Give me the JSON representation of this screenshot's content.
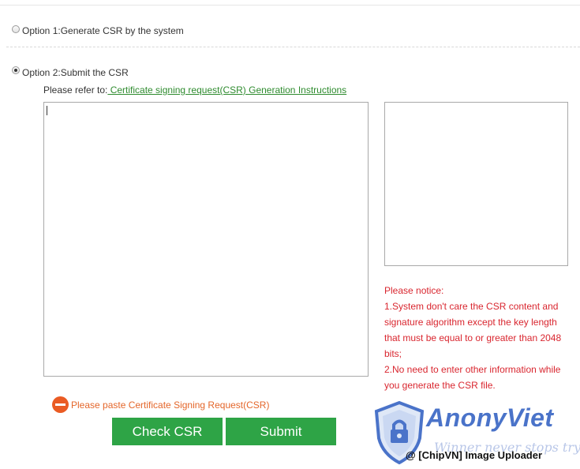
{
  "options": [
    {
      "label": "Option 1:Generate CSR by the system",
      "selected": false
    },
    {
      "label": "Option 2:Submit the CSR",
      "selected": true
    }
  ],
  "refer": {
    "prefix": "Please refer to:",
    "link_text": " Certificate signing request(CSR) Generation Instructions"
  },
  "csr_textarea": {
    "value": ""
  },
  "notice": {
    "title": "Please notice:",
    "line1": "1.System don't care the CSR content and signature algorithm except the key length that must be equal to or greater than 2048 bits;",
    "line2": "2.No need to enter other information while you generate the CSR file."
  },
  "error_message": "Please paste Certificate Signing Request(CSR)",
  "buttons": {
    "check": "Check CSR",
    "submit": "Submit"
  },
  "watermark": {
    "brand": "AnonyViet",
    "slogan": "Winner never stops trying",
    "uploader": "@ [ChipVN] Image Uploader"
  },
  "colors": {
    "button_green": "#2ea446",
    "notice_red": "#d9262f",
    "error_orange": "#ea5b23",
    "link_green": "#2e8b2e"
  }
}
